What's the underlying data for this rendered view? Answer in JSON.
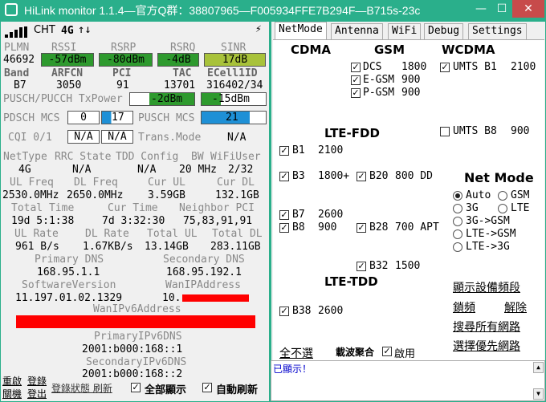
{
  "window": {
    "title": "HiLink monitor 1.1.4—官方Q群：38807965—F005934FFE7B294F—B715s-23c",
    "min": "—",
    "max": "☐",
    "close": "✕"
  },
  "status": {
    "carrier": "CHT",
    "network": "4G",
    "arrows": "↑↓",
    "bolt": "⚡"
  },
  "signal": {
    "headers": [
      "PLMN",
      "RSSI",
      "RSRP",
      "RSRQ",
      "SINR"
    ],
    "plmn": "46692",
    "rssi": "-57dBm",
    "rsrp": "-80dBm",
    "rsrq": "-4dB",
    "sinr": "17dB",
    "row2_headers": [
      "Band",
      "ARFCN",
      "PCI",
      "TAC",
      "ECell1ID"
    ],
    "band": "B7",
    "arfcn": "3050",
    "pci": "91",
    "tac": "13701",
    "ecellid": "316402/34",
    "txpower_label": "PUSCH/PUCCH TxPower",
    "tx1": "-2dBm",
    "tx2": "-15dBm",
    "pdsch_label": "PDSCH MCS",
    "pdsch_a": "0",
    "pdsch_b": "17",
    "pusch_label": "PUSCH MCS",
    "pusch_val": "21",
    "cqi_label": "CQI 0/1",
    "cqi_a": "N/A",
    "cqi_b": "N/A",
    "trans_label": "Trans.Mode",
    "trans_val": "N/A"
  },
  "colors": {
    "rssi": "#2e9a2e",
    "rsrp": "#2e9a2e",
    "rsrq": "#2e9a2e",
    "sinr": "#a8c23a",
    "tx1": "#2e9a2e",
    "tx2": "#2e9a2e",
    "mcs": "#1e90d6",
    "title": "#2aaf8b"
  },
  "info": {
    "h1": [
      "NetType",
      "RRC State",
      "TDD Config",
      "BW",
      "WiFiUser"
    ],
    "nettype": "4G",
    "rrc": "N/A",
    "tdd": "N/A",
    "bw": "20 MHz",
    "wifiuser": "2/32",
    "h2": [
      "UL Freq",
      "DL Freq",
      "Cur UL",
      "Cur DL"
    ],
    "ulfreq": "2530.0MHz",
    "dlfreq": "2650.0MHz",
    "curul": "3.59GB",
    "curdl": "132.1GB",
    "h3": [
      "Total Time",
      "Cur Time",
      "Neighbor PCI"
    ],
    "totaltime": "19d 5:1:38",
    "curtime": "7d 3:32:30",
    "neighbor": "75,83,91,91",
    "h4": [
      "UL Rate",
      "DL Rate",
      "Total UL",
      "Total DL"
    ],
    "ulrate": "961 B/s",
    "dlrate": "1.67KB/s",
    "totalul": "13.14GB",
    "totaldl": "283.11GB",
    "pdns_label": "Primary DNS",
    "pdns": "168.95.1.1",
    "sdns_label": "Secondary DNS",
    "sdns": "168.95.192.1",
    "sw_label": "SoftwareVersion",
    "sw": "11.197.01.02.1329",
    "wanip_label": "WanIPAddress",
    "wanip": "10.",
    "wanv6_label": "WanIPv6Address",
    "p6dns_label": "PrimaryIPv6DNS",
    "p6dns": "2001:b000:168::1",
    "s6dns_label": "SecondaryIPv6DNS",
    "s6dns": "2001:b000:168::2"
  },
  "bottom": {
    "restart": "重啟",
    "login": "登錄",
    "logout": "登出",
    "status_link": "登錄狀態 刷新",
    "show_all": "全部顯示",
    "auto_refresh": "自動刷新",
    "restart2": "關機"
  },
  "tabs": [
    "NetMode",
    "Antenna",
    "WiFi",
    "Debug",
    "Settings"
  ],
  "netmode": {
    "cdma": "CDMA",
    "gsm": "GSM",
    "wcdma": "WCDMA",
    "gsm_opts": [
      {
        "label": "DCS",
        "freq": "1800"
      },
      {
        "label": "E-GSM",
        "freq": "900"
      },
      {
        "label": "P-GSM",
        "freq": "900"
      }
    ],
    "wcdma_opts": [
      {
        "label": "UMTS B1",
        "freq": "2100"
      },
      {
        "label": "UMTS B8",
        "freq": "900"
      }
    ],
    "ltefdd": "LTE-FDD",
    "ltetdd": "LTE-TDD",
    "fdd_col1": [
      {
        "label": "B1",
        "freq": "2100"
      },
      {
        "label": "B3",
        "freq": "1800+"
      },
      {
        "label": "B7",
        "freq": "2600"
      },
      {
        "label": "B8",
        "freq": "900"
      }
    ],
    "fdd_col2": [
      {
        "label": "B20",
        "freq": "800 DD"
      },
      {
        "label": "B28",
        "freq": "700 APT"
      },
      {
        "label": "B32",
        "freq": "1500"
      }
    ],
    "tdd": [
      {
        "label": "B38",
        "freq": "2600"
      }
    ],
    "netmode_title": "Net Mode",
    "modes": [
      "Auto",
      "GSM",
      "3G",
      "LTE",
      "3G->GSM",
      "LTE->GSM",
      "LTE->3G"
    ],
    "selected_mode": "Auto",
    "links": [
      "顯示設備頻段",
      "鎖頻",
      "解除",
      "搜尋所有網路",
      "選擇優先網路"
    ],
    "deselect_all": "全不選",
    "carrier_agg": "載波聚合",
    "enable": "啟用",
    "log": "已顯示！"
  }
}
